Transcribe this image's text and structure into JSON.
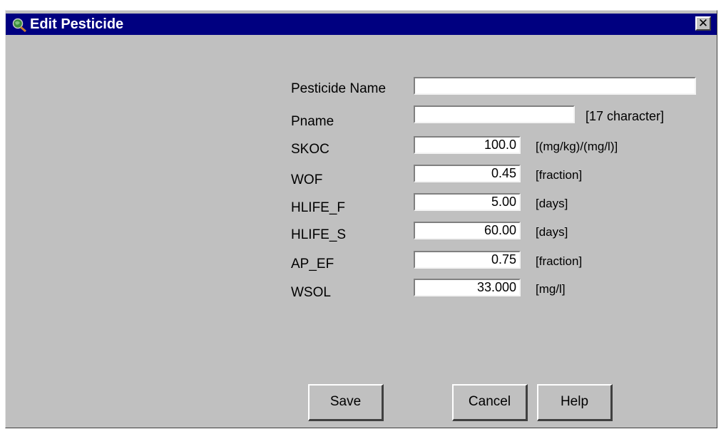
{
  "window": {
    "title": "Edit  Pesticide",
    "close_glyph": "✕"
  },
  "fields": [
    {
      "label": "Pesticide Name",
      "value": "",
      "unit": ""
    },
    {
      "label": "Pname",
      "value": "",
      "unit": "[17 character]"
    },
    {
      "label": "SKOC",
      "value": "100.0",
      "unit": "[(mg/kg)/(mg/l)]"
    },
    {
      "label": "WOF",
      "value": "0.45",
      "unit": "[fraction]"
    },
    {
      "label": "HLIFE_F",
      "value": "5.00",
      "unit": "[days]"
    },
    {
      "label": "HLIFE_S",
      "value": "60.00",
      "unit": "[days]"
    },
    {
      "label": "AP_EF",
      "value": "0.75",
      "unit": "[fraction]"
    },
    {
      "label": "WSOL",
      "value": "33.000",
      "unit": "[mg/l]"
    }
  ],
  "buttons": {
    "save": "Save",
    "cancel": "Cancel",
    "help": "Help"
  },
  "colors": {
    "titlebar": "#000080",
    "dialog": "#c0c0c0"
  },
  "icons": {
    "app": "globe-magnifier-icon",
    "close": "close-icon"
  }
}
